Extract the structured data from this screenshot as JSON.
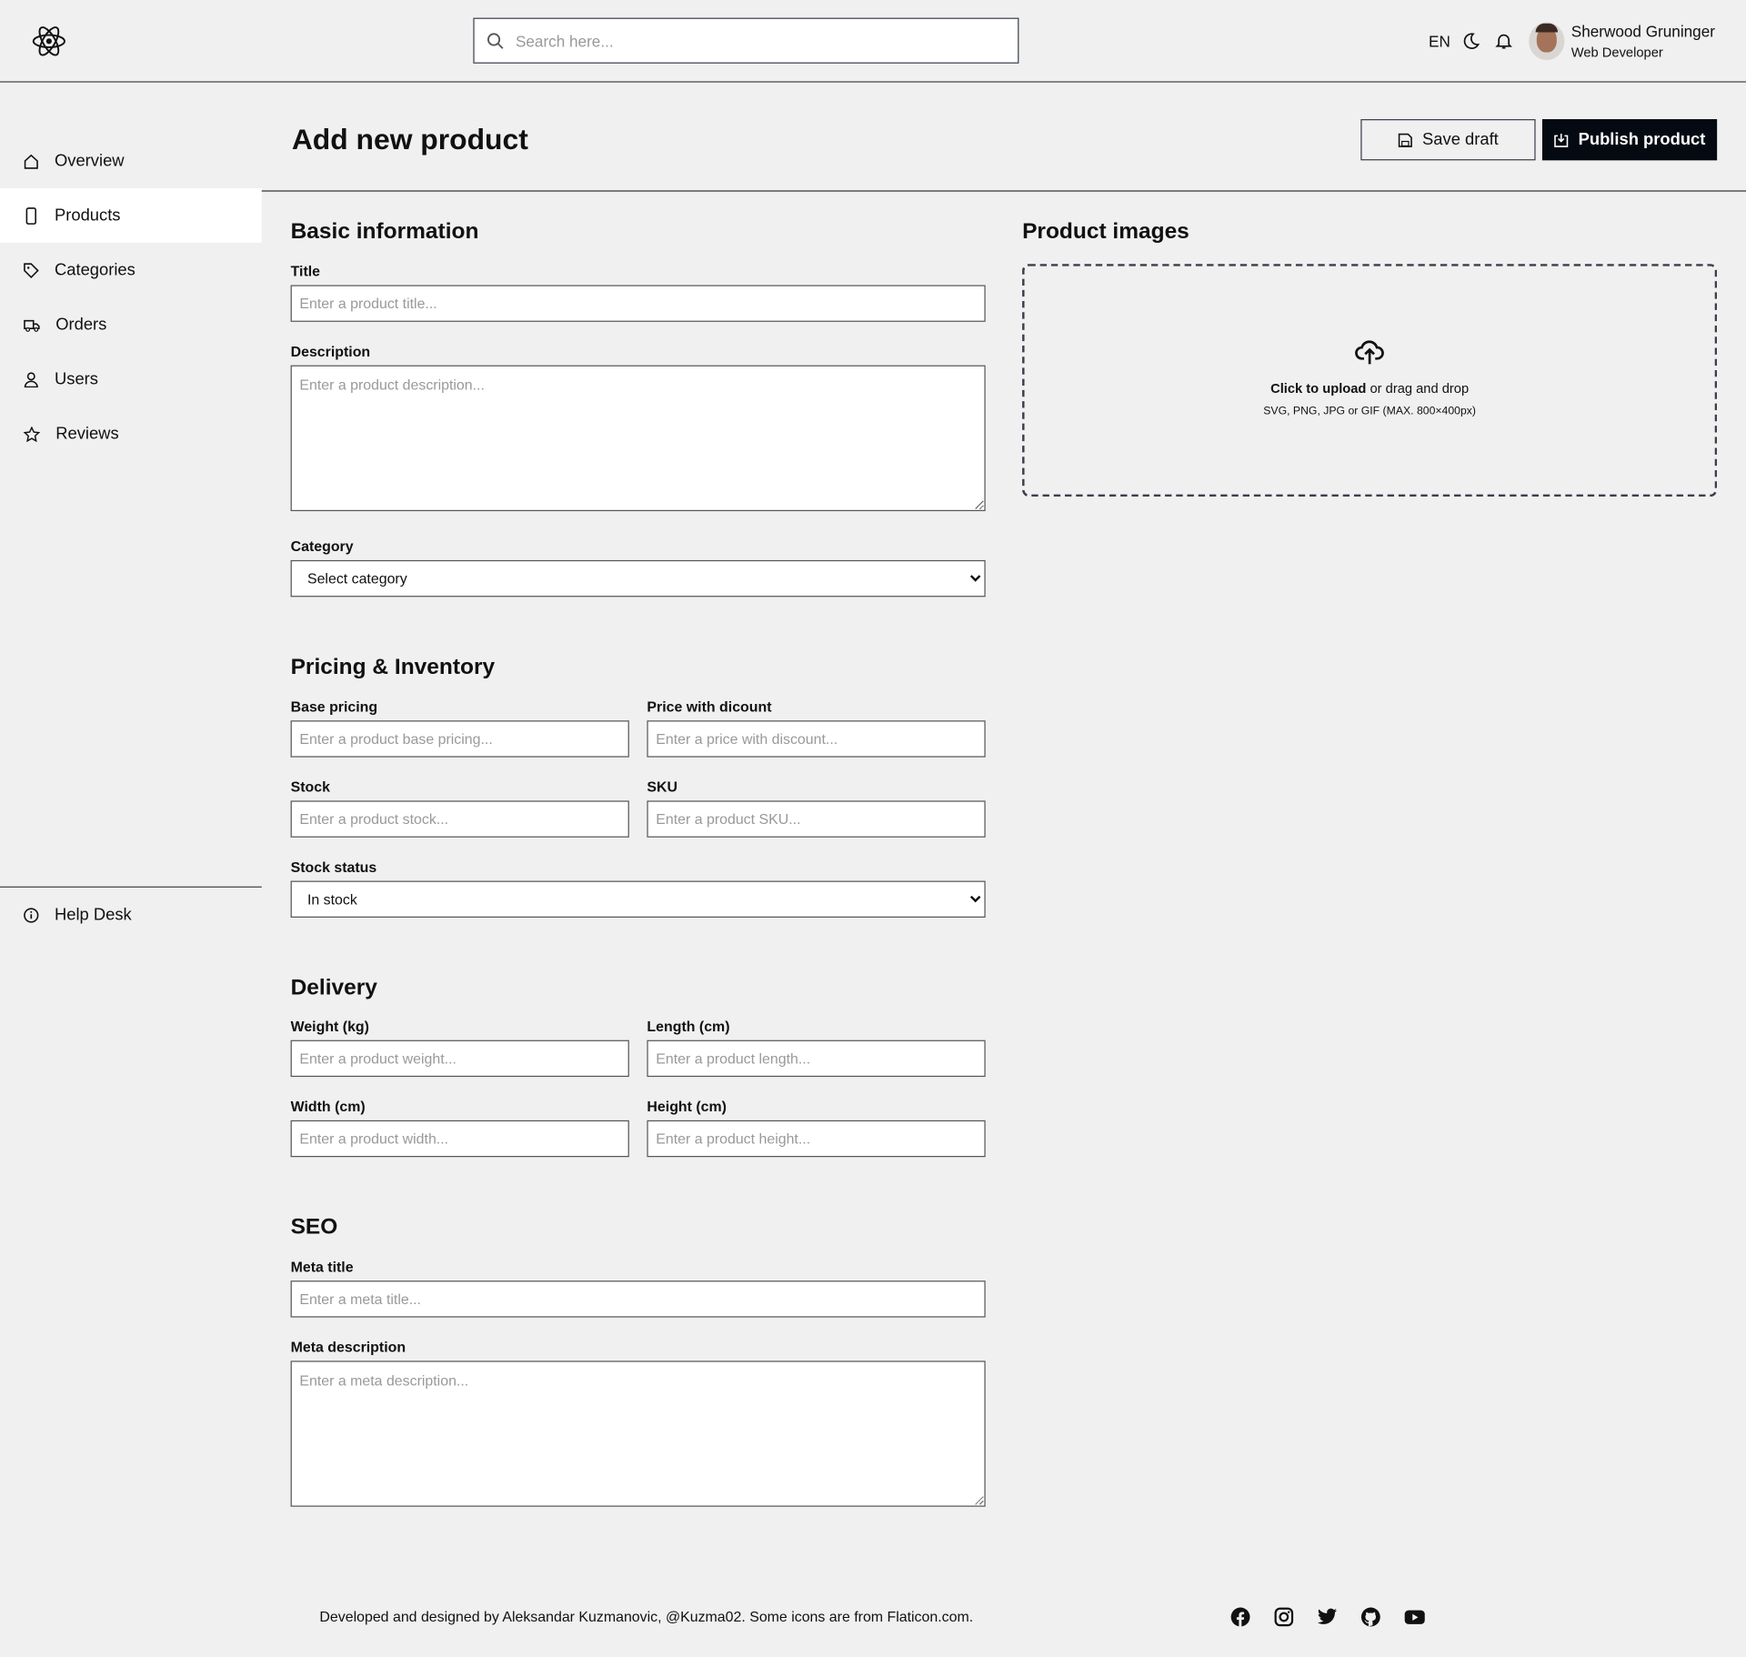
{
  "header": {
    "search_placeholder": "Search here...",
    "language": "EN",
    "user": {
      "name": "Sherwood Gruninger",
      "role": "Web Developer"
    }
  },
  "sidebar": {
    "items": [
      {
        "label": "Overview",
        "icon": "home-icon"
      },
      {
        "label": "Products",
        "icon": "phone-icon",
        "active": true
      },
      {
        "label": "Categories",
        "icon": "tag-icon"
      },
      {
        "label": "Orders",
        "icon": "truck-icon"
      },
      {
        "label": "Users",
        "icon": "user-icon"
      },
      {
        "label": "Reviews",
        "icon": "star-icon"
      }
    ],
    "help": "Help Desk"
  },
  "page": {
    "title": "Add new product",
    "save_draft": "Save draft",
    "publish": "Publish product"
  },
  "basic": {
    "heading": "Basic information",
    "title_label": "Title",
    "title_placeholder": "Enter a product title...",
    "desc_label": "Description",
    "desc_placeholder": "Enter a product description...",
    "category_label": "Category",
    "category_value": "Select category"
  },
  "images": {
    "heading": "Product images",
    "click": "Click to upload",
    "drag": " or drag and drop",
    "formats": "SVG, PNG, JPG or GIF (MAX. 800×400px)"
  },
  "pricing": {
    "heading": "Pricing & Inventory",
    "base_label": "Base pricing",
    "base_placeholder": "Enter a product base pricing...",
    "discount_label": "Price with dicount",
    "discount_placeholder": "Enter a price with discount...",
    "stock_label": "Stock",
    "stock_placeholder": "Enter a product stock...",
    "sku_label": "SKU",
    "sku_placeholder": "Enter a product SKU...",
    "status_label": "Stock status",
    "status_value": "In stock"
  },
  "delivery": {
    "heading": "Delivery",
    "weight_label": "Weight (kg)",
    "weight_placeholder": "Enter a product weight...",
    "length_label": "Length (cm)",
    "length_placeholder": "Enter a product length...",
    "width_label": "Width (cm)",
    "width_placeholder": "Enter a product width...",
    "height_label": "Height (cm)",
    "height_placeholder": "Enter a product height..."
  },
  "seo": {
    "heading": "SEO",
    "meta_title_label": "Meta title",
    "meta_title_placeholder": "Enter a meta title...",
    "meta_desc_label": "Meta description",
    "meta_desc_placeholder": "Enter a meta description..."
  },
  "footer": {
    "text": "Developed and designed by Aleksandar Kuzmanovic, @Kuzma02. Some icons are from Flaticon.com.",
    "social": [
      "facebook-icon",
      "instagram-icon",
      "twitter-icon",
      "github-icon",
      "youtube-icon"
    ]
  }
}
